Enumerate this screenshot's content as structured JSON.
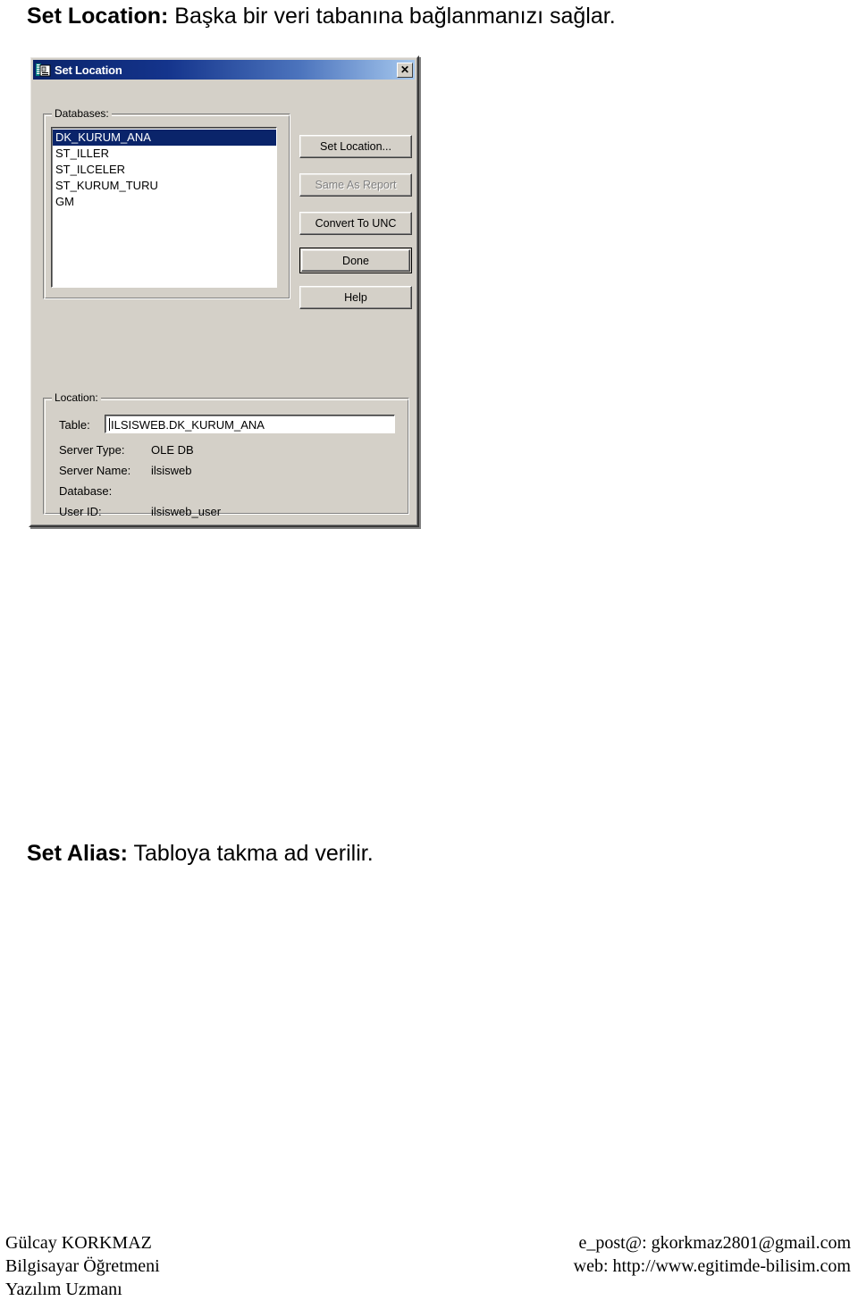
{
  "document": {
    "headings": [
      {
        "lead": "Set Location:",
        "rest": " Başka bir veri tabanına bağlanmanızı sağlar."
      },
      {
        "lead": "Set Alias:",
        "rest": " Tabloya takma ad verilir."
      }
    ]
  },
  "dialog": {
    "title": "Set Location",
    "icon": "database-table-icon",
    "close_label": "✕",
    "databases_group": {
      "label": "Databases:",
      "items": [
        {
          "label": "DK_KURUM_ANA",
          "selected": true
        },
        {
          "label": "ST_ILLER",
          "selected": false
        },
        {
          "label": "ST_ILCELER",
          "selected": false
        },
        {
          "label": "ST_KURUM_TURU",
          "selected": false
        },
        {
          "label": "GM",
          "selected": false
        }
      ]
    },
    "buttons": [
      {
        "id": "set-location",
        "label": "Set Location...",
        "disabled": false,
        "default": false
      },
      {
        "id": "same-as-report",
        "label": "Same As Report",
        "disabled": true,
        "default": false
      },
      {
        "id": "convert-to-unc",
        "label": "Convert To UNC",
        "disabled": false,
        "default": false
      },
      {
        "id": "done",
        "label": "Done",
        "disabled": false,
        "default": true
      },
      {
        "id": "help",
        "label": "Help",
        "disabled": false,
        "default": false
      }
    ],
    "location_group": {
      "label": "Location:",
      "table_label": "Table:",
      "table_value": "ILSISWEB.DK_KURUM_ANA",
      "fields": [
        {
          "label": "Server Type:",
          "value": "OLE DB"
        },
        {
          "label": "Server Name:",
          "value": "ilsisweb"
        },
        {
          "label": "Database:",
          "value": ""
        },
        {
          "label": "User ID:",
          "value": "ilsisweb_user"
        }
      ]
    },
    "colors": {
      "face": "#d4d0c8",
      "titlebar_start": "#0a246a",
      "titlebar_end": "#a6c8ee",
      "selection": "#0a246a"
    }
  },
  "footer": {
    "left": [
      "Gülcay KORKMAZ",
      "Bilgisayar Öğretmeni",
      "Yazılım Uzmanı"
    ],
    "right": [
      "e_post@: gkorkmaz2801@gmail.com",
      "web:  http://www.egitimde-bilisim.com"
    ]
  }
}
